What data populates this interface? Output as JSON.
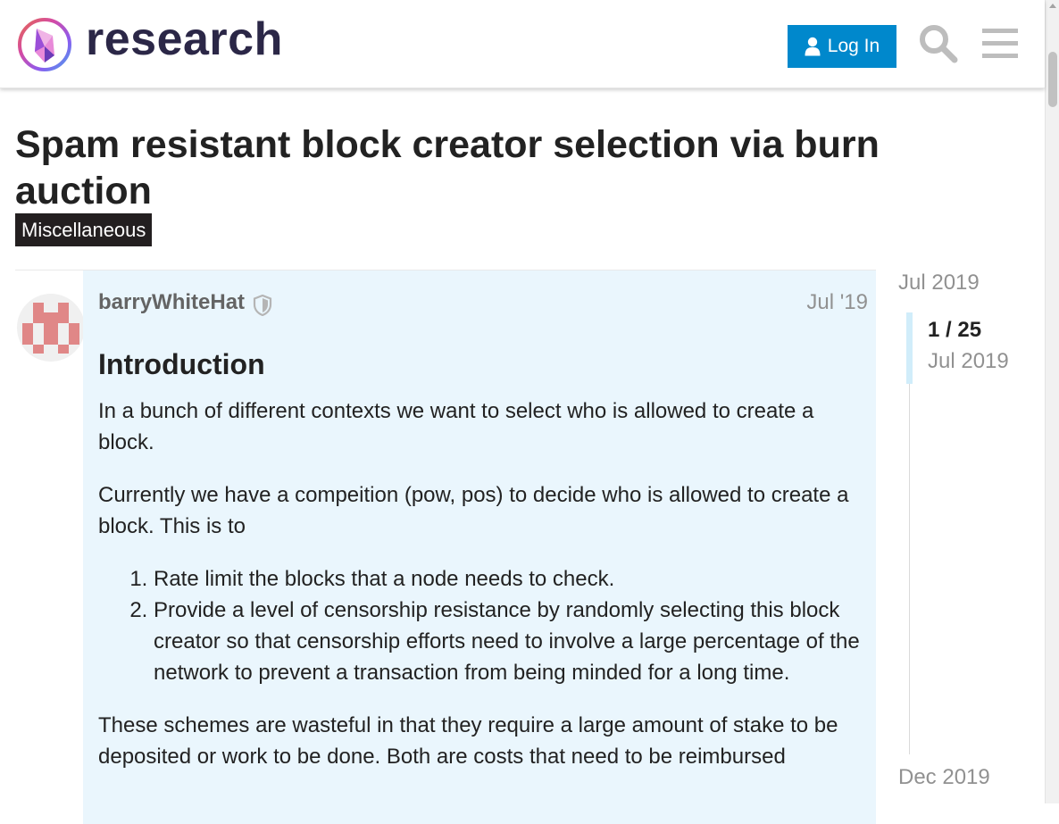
{
  "header": {
    "site_name": "research",
    "login_label": "Log In",
    "icons": {
      "logo": "ethereum-logo",
      "user": "user-icon",
      "search": "search-icon",
      "menu": "hamburger-menu-icon"
    },
    "accent_color": "#0088cc"
  },
  "topic": {
    "title": "Spam resistant block creator selection via burn auction",
    "category": "Miscellaneous",
    "category_color": "#231f20"
  },
  "post": {
    "username": "barryWhiteHat",
    "date": "Jul '19",
    "heading": "Introduction",
    "paragraphs": [
      "In a bunch of different contexts we want to select who is allowed to create a block.",
      "Currently we have a compeition (pow, pos) to decide who is allowed to create a block. This is to",
      "These schemes are wasteful in that they require a large amount of stake to be deposited or work to be done. Both are costs that need to be reimbursed"
    ],
    "list_items": [
      "Rate limit the blocks that a node needs to check.",
      "Provide a level of censorship resistance by randomly selecting this block creator so that censorship efforts need to involve a large percentage of the network to prevent a transaction from being minded for a long time."
    ],
    "background_color": "#eaf6fd"
  },
  "timeline": {
    "start_date": "Jul 2019",
    "position": "1 / 25",
    "current_date": "Jul 2019",
    "end_date": "Dec 2019"
  }
}
